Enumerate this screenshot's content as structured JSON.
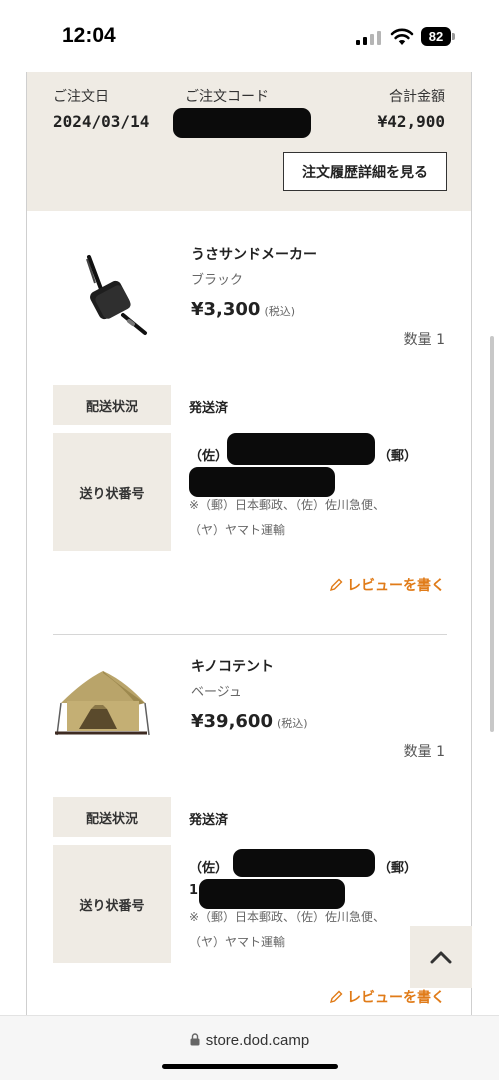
{
  "status_bar": {
    "time": "12:04",
    "battery": "82"
  },
  "summary": {
    "order_date_label": "ご注文日",
    "order_date": "2024/03/14",
    "order_code_label": "ご注文コード",
    "total_label": "合計金額",
    "total": "¥42,900",
    "detail_button": "注文履歴詳細を見る"
  },
  "items": [
    {
      "name": "うさサンドメーカー",
      "variant": "ブラック",
      "price": "¥3,300",
      "tax_note": "(税込)",
      "quantity": "数量 1",
      "status_label": "配送状況",
      "status": "発送済",
      "tracking_label": "送り状番号",
      "tracking_line1": "（佐）",
      "tracking_line1_suffix": "（郵）",
      "carrier_note1": "※（郵）日本郵政、（佐）佐川急便、",
      "carrier_note2": "（ヤ）ヤマト運輸",
      "review_link": "レビューを書く"
    },
    {
      "name": "キノコテント",
      "variant": "ベージュ",
      "price": "¥39,600",
      "tax_note": "(税込)",
      "quantity": "数量 1",
      "status_label": "配送状況",
      "status": "発送済",
      "tracking_label": "送り状番号",
      "tracking_line1": "（佐）",
      "tracking_line1_suffix": "（郵）",
      "tracking_line2_prefix": "1",
      "carrier_note1": "※（郵）日本郵政、（佐）佐川急便、",
      "carrier_note2": "（ヤ）ヤマト運輸",
      "review_link": "レビューを書く"
    }
  ],
  "browser": {
    "url": "store.dod.camp"
  },
  "colors": {
    "accent": "#e07b18",
    "panel": "#efebe4"
  },
  "icons": [
    "signal-icon",
    "wifi-icon",
    "battery-icon",
    "pencil-icon",
    "chevron-up-icon",
    "lock-icon"
  ]
}
